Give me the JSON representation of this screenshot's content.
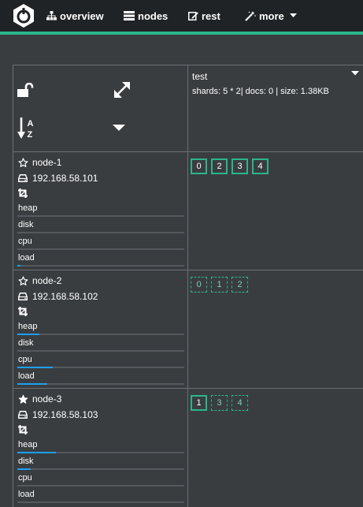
{
  "navbar": {
    "items": [
      {
        "label": "overview",
        "icon": "sitemap-icon"
      },
      {
        "label": "nodes",
        "icon": "server-icon"
      },
      {
        "label": "rest",
        "icon": "edit-icon"
      },
      {
        "label": "more",
        "icon": "wand-icon"
      }
    ]
  },
  "colors": {
    "accent": "#2bb58b",
    "navbar": "#202326",
    "background": "#3a3d40",
    "bar": "#1e9ff2"
  },
  "index": {
    "name": "test",
    "stats": "shards: 5 * 2| docs: 0 | size: 1.38KB"
  },
  "metric_labels": [
    "heap",
    "disk",
    "cpu",
    "load"
  ],
  "nodes": [
    {
      "name": "node-1",
      "ip": "192.168.58.101",
      "master": false,
      "metrics": [
        0.0,
        0.0,
        0.0,
        0.02
      ],
      "shards": [
        {
          "label": "0",
          "primary": true
        },
        {
          "label": "2",
          "primary": true
        },
        {
          "label": "3",
          "primary": true
        },
        {
          "label": "4",
          "primary": true
        }
      ]
    },
    {
      "name": "node-2",
      "ip": "192.168.58.102",
      "master": false,
      "metrics": [
        0.13,
        0.0,
        0.21,
        0.18
      ],
      "shards": [
        {
          "label": "0",
          "primary": false
        },
        {
          "label": "1",
          "primary": false
        },
        {
          "label": "2",
          "primary": false
        }
      ]
    },
    {
      "name": "node-3",
      "ip": "192.168.58.103",
      "master": true,
      "metrics": [
        0.23,
        0.08,
        0.0,
        0.0
      ],
      "shards": [
        {
          "label": "1",
          "primary": true
        },
        {
          "label": "3",
          "primary": false
        },
        {
          "label": "4",
          "primary": false
        }
      ]
    }
  ]
}
